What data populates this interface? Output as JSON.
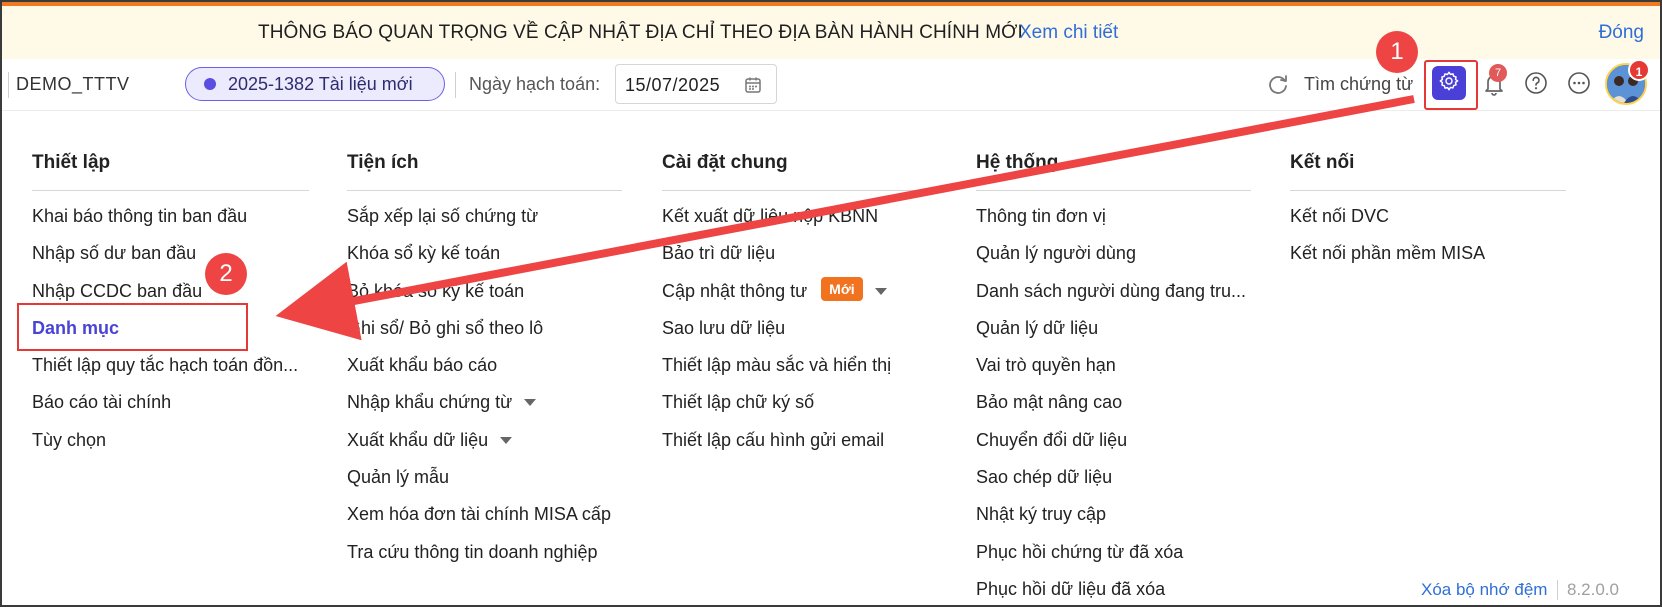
{
  "notice": {
    "text": "THÔNG BÁO QUAN TRỌNG VỀ CẬP NHẬT ĐỊA CHỈ THEO ĐỊA BÀN HÀNH CHÍNH MỚI",
    "link": "Xem chi tiết",
    "close": "Đóng"
  },
  "toolbar": {
    "company": "DEMO_TTTV",
    "period": "2025-1382 Tài liệu mới",
    "date_label": "Ngày hạch toán:",
    "date_value": "15/07/2025",
    "search_label": "Tìm chứng từ",
    "notification_count": "7",
    "avatar_badge": "1"
  },
  "annotations": {
    "step1": "1",
    "step2": "2",
    "accent": "#e53935"
  },
  "menu": {
    "thiet_lap": {
      "title": "Thiết lập",
      "items": [
        "Khai báo thông tin ban đầu",
        "Nhập số dư ban đầu",
        "Nhập CCDC ban đầu",
        "Danh mục",
        "Thiết lập quy tắc hạch toán đồn...",
        "Báo cáo tài chính",
        "Tùy chọn"
      ]
    },
    "tien_ich": {
      "title": "Tiện ích",
      "items": [
        "Sắp xếp lại số chứng từ",
        "Khóa sổ kỳ kế toán",
        "Bỏ khóa sổ kỳ kế toán",
        "Ghi sổ/ Bỏ ghi sổ theo lô",
        "Xuất khẩu báo cáo",
        "Nhập khẩu chứng từ",
        "Xuất khẩu dữ liệu",
        "Quản lý mẫu",
        "Xem hóa đơn tài chính MISA cấp",
        "Tra cứu thông tin doanh nghiệp"
      ]
    },
    "cai_dat_chung": {
      "title": "Cài đặt chung",
      "items": [
        "Kết xuất dữ liệu nộp KBNN",
        "Bảo trì dữ liệu",
        "Cập nhật thông tư",
        "Sao lưu dữ liệu",
        "Thiết lập màu sắc và hiển thị",
        "Thiết lập chữ ký số",
        "Thiết lập cấu hình gửi email"
      ],
      "new_badge": "Mới"
    },
    "he_thong": {
      "title": "Hệ thống",
      "items": [
        "Thông tin đơn vị",
        "Quản lý người dùng",
        "Danh sách người dùng đang tru...",
        "Quản lý dữ liệu",
        "Vai trò quyền hạn",
        "Bảo mật nâng cao",
        "Chuyển đổi dữ liệu",
        "Sao chép dữ liệu",
        "Nhật ký truy cập",
        "Phục hồi chứng từ đã xóa",
        "Phục hồi dữ liệu đã xóa"
      ]
    },
    "ket_noi": {
      "title": "Kết nối",
      "items": [
        "Kết nối DVC",
        "Kết nối phần mềm MISA"
      ]
    }
  },
  "footer": {
    "clear_cache": "Xóa bộ nhớ đệm",
    "version": "8.2.0.0"
  }
}
